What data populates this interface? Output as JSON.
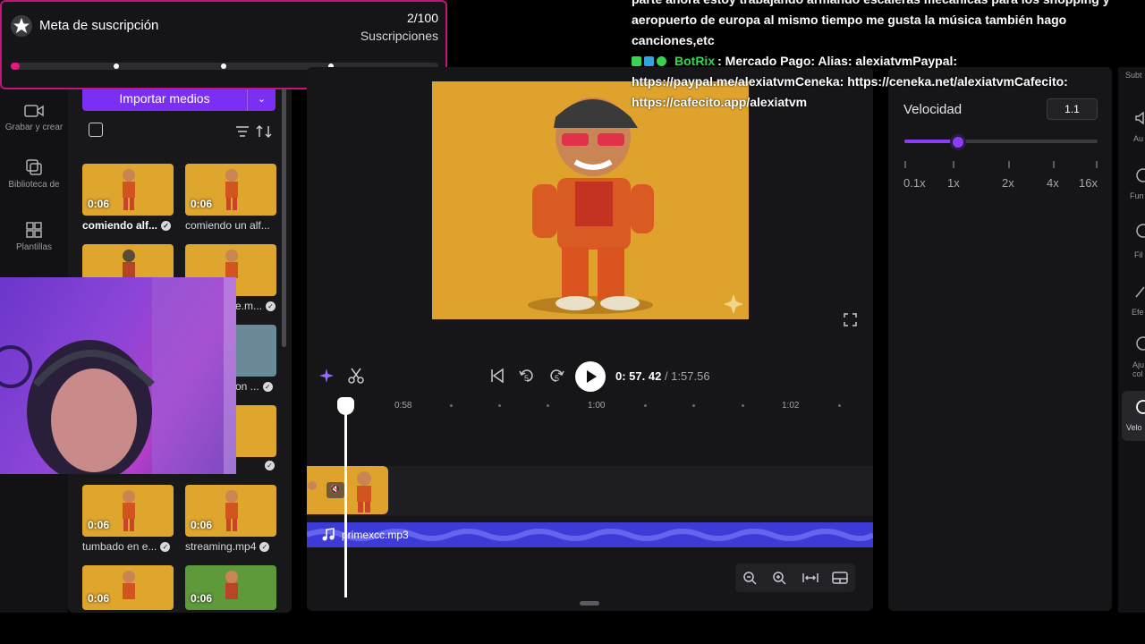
{
  "left_rail": {
    "items": [
      {
        "label": "Grabar y crear",
        "icon": "camera-icon"
      },
      {
        "label": "Biblioteca de",
        "icon": "library-icon"
      },
      {
        "label": "Plantillas",
        "icon": "templates-icon"
      }
    ]
  },
  "media_panel": {
    "import_label": "Importar medios",
    "items": [
      {
        "duration": "0:06",
        "caption": "comiendo alf...",
        "selected": true
      },
      {
        "duration": "0:06",
        "caption": "comiendo un alf...",
        "selected": false
      },
      {
        "duration": "",
        "caption": "",
        "selected": false
      },
      {
        "duration": "",
        "caption": "e.m...",
        "selected": false
      },
      {
        "duration": "",
        "caption": "on ...",
        "selected": false
      },
      {
        "duration": "",
        "caption": "",
        "selected": false
      },
      {
        "duration": "0:06",
        "caption": "tumbado en e...",
        "selected": false
      },
      {
        "duration": "0:06",
        "caption": "streaming.mp4",
        "selected": false
      },
      {
        "duration": "0:06",
        "caption": "",
        "selected": false
      },
      {
        "duration": "0:06",
        "caption": "",
        "selected": false
      }
    ]
  },
  "subscription_goal": {
    "title": "Meta de suscripción",
    "count": "2/100",
    "label": "Suscripciones",
    "progress": 0.02,
    "accent": "#e8177f"
  },
  "player": {
    "current_time": "0: 57. 42",
    "total_time": "/ 1:57.56",
    "rewind_label": "5",
    "forward_label": "5",
    "ruler_labels": [
      "0:58",
      "1:00",
      "1:02"
    ]
  },
  "timeline": {
    "audio_name": "primexcc.mp3"
  },
  "speed_panel": {
    "label": "Velocidad",
    "value": "1.1",
    "slider_fraction": 0.28,
    "ticks": [
      "0.1x",
      "1x",
      "2x",
      "4x",
      "16x"
    ]
  },
  "right_rail": {
    "items": [
      "Subt",
      "Au",
      "Fun",
      "Fil",
      "Efe",
      "Aju",
      "col",
      "Velo"
    ]
  },
  "chat": {
    "line1": "parte ahora estoy trabajando armando escaleras mecánicas para los shopping y",
    "line2": "aeropuerto de europa al mismo tiempo me gusta la música también hago",
    "line3": "canciones,etc",
    "bot_name": "BotRix",
    "bot_message": ": Mercado Pago: Alias: alexiatvmPaypal:",
    "bot_line2": "https://paypal.me/alexiatvmCeneka: https://ceneka.net/alexiatvmCafecito:",
    "bot_line3": "https://cafecito.app/alexiatvm"
  }
}
